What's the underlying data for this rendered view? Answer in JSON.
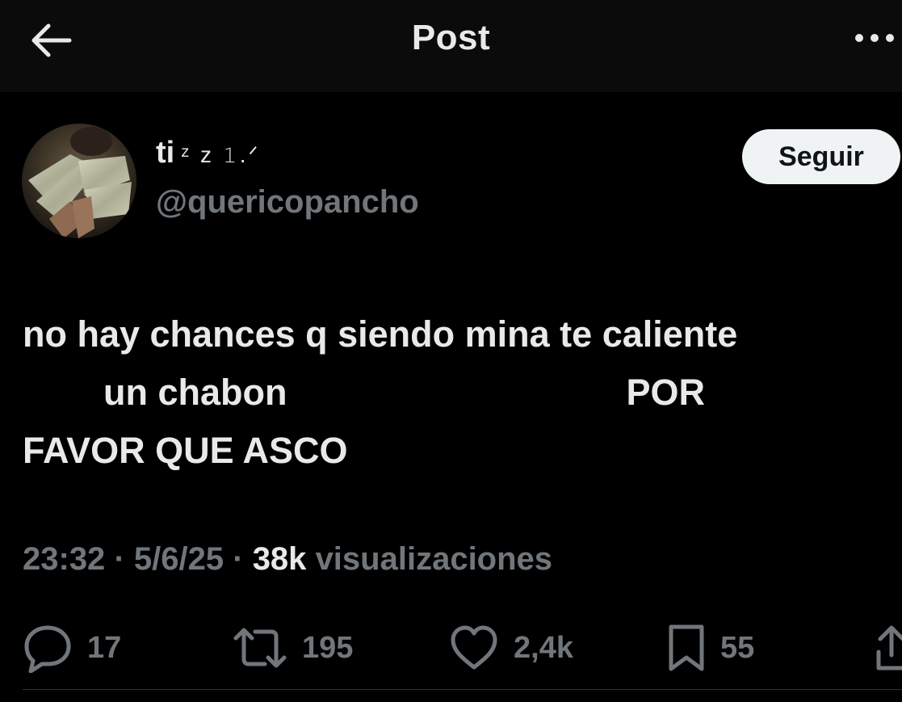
{
  "header": {
    "title": "Post",
    "back_icon": "arrow-left-icon",
    "more_icon": "more-horizontal-icon"
  },
  "author": {
    "display_name": "ti",
    "display_name_decoration": "ᶻ z 𝟷.ᐟ",
    "handle": "@quericopancho",
    "follow_label": "Seguir"
  },
  "tweet": {
    "lines": [
      "no hay chances q siendo mina te caliente",
      "un chabon",
      "POR",
      "FAVOR QUE ASCO"
    ]
  },
  "meta": {
    "time": "23:32",
    "separator": "·",
    "date": "5/6/25",
    "views_count": "38k",
    "views_label": "visualizaciones"
  },
  "actions": {
    "replies": "17",
    "reposts": "195",
    "likes": "2,4k",
    "bookmarks": "55"
  },
  "colors": {
    "background": "#000000",
    "header_background": "#0b0b0b",
    "primary_text": "#e7e9ea",
    "secondary_text": "#71767b",
    "follow_button_bg": "#eff3f4",
    "divider": "#2f3336"
  }
}
